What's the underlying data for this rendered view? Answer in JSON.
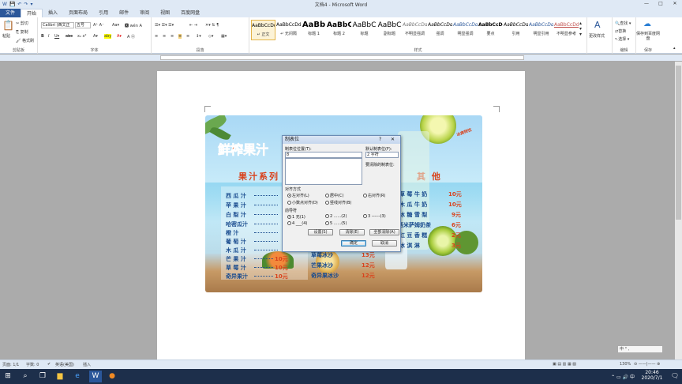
{
  "window": {
    "title": "文档4 - Microsoft Word",
    "minimize": "—",
    "maximize": "□",
    "close": "✕"
  },
  "quick_access": [
    "W",
    "💾",
    "↶",
    "↷",
    "▾"
  ],
  "tabs": [
    "文件",
    "开始",
    "插入",
    "页面布局",
    "引用",
    "邮件",
    "审阅",
    "视图",
    "百度网盘"
  ],
  "ribbon": {
    "clipboard": {
      "paste": "粘贴",
      "cut": "剪切",
      "copy": "复制",
      "format_painter": "格式刷",
      "label": "剪贴板"
    },
    "font": {
      "font_name": "Calibri (西文正",
      "font_size": "五号",
      "label": "字体"
    },
    "paragraph": {
      "label": "段落"
    },
    "styles": {
      "label": "样式",
      "items": [
        {
          "preview": "AaBbCcDd",
          "name": "↵ 正文"
        },
        {
          "preview": "AaBbCcDd",
          "name": "↵ 无间隔"
        },
        {
          "preview": "AaBb",
          "name": "标题 1"
        },
        {
          "preview": "AaBbC",
          "name": "标题 2"
        },
        {
          "preview": "AaBbC",
          "name": "标题"
        },
        {
          "preview": "AaBbC",
          "name": "副标题"
        },
        {
          "preview": "AaBbCcDd",
          "name": "不明显强调"
        },
        {
          "preview": "AaBbCcDd",
          "name": "强调"
        },
        {
          "preview": "AaBbCcDd",
          "name": "明显强调"
        },
        {
          "preview": "AaBbCcDd",
          "name": "要点"
        },
        {
          "preview": "AaBbCcDd",
          "name": "引用"
        },
        {
          "preview": "AaBbCcDd",
          "name": "明显引用"
        },
        {
          "preview": "AaBbCcDd",
          "name": "不明显参考"
        }
      ],
      "change_styles": "更改样式"
    },
    "editing": {
      "find": "查找 ▾",
      "replace": "替换",
      "select": "选择 ▾",
      "label": "编辑"
    },
    "save": {
      "button": "保存到百度网盘",
      "label": "保存"
    }
  },
  "menu_image": {
    "title": "鲜榨果汁",
    "juice_section": "果汁系列",
    "other_section": "其 他",
    "badge": "冰爽特饮",
    "juices": [
      {
        "name": "西 瓜 汁",
        "price": ""
      },
      {
        "name": "苹 果 汁",
        "price": ""
      },
      {
        "name": "白 梨 汁",
        "price": ""
      },
      {
        "name": "哈密瓜汁",
        "price": ""
      },
      {
        "name": "橙 汁",
        "price": ""
      },
      {
        "name": "葡 萄 汁",
        "price": ""
      },
      {
        "name": "木 瓜 汁",
        "price": ""
      },
      {
        "name": "芒 果 汁",
        "price": "10元"
      },
      {
        "name": "草 莓 汁",
        "price": "10元"
      },
      {
        "name": "奇异果汁",
        "price": "10元"
      }
    ],
    "middle": [
      {
        "name": "草莓冰沙",
        "price": "13元"
      },
      {
        "name": "芒果冰沙",
        "price": "12元"
      },
      {
        "name": "奇异果冰沙",
        "price": "12元"
      }
    ],
    "others": [
      {
        "name": "草 莓 牛 奶",
        "price": "10元"
      },
      {
        "name": "木 瓜 牛 奶",
        "price": "10元"
      },
      {
        "name": "冰 糖 雪 梨",
        "price": "9元"
      },
      {
        "name": "西米萨姆奶茶",
        "price": "6元"
      },
      {
        "name": "红 豆 香 糕",
        "price": "2元"
      },
      {
        "name": "冰 淇 淋",
        "price": "3元"
      }
    ]
  },
  "dialog": {
    "title": "制表位",
    "help": "?",
    "close": "✕",
    "tab_position_label": "制表位位置(T):",
    "tab_position_value": "8",
    "default_tabs_label": "默认制表位(F):",
    "default_tabs_value": "2 字符",
    "to_clear_label": "要清除的制表位:",
    "alignment_label": "对齐方式",
    "alignment": [
      {
        "label": "左对齐(L)",
        "selected": true
      },
      {
        "label": "居中(C)",
        "selected": false
      },
      {
        "label": "右对齐(R)",
        "selected": false
      },
      {
        "label": "小数点对齐(D)",
        "selected": false
      },
      {
        "label": "竖线对齐(B)",
        "selected": false
      }
    ],
    "leader_label": "前导符",
    "leaders": [
      {
        "label": "1 无(1)",
        "selected": true
      },
      {
        "label": "2 ......(2)",
        "selected": false
      },
      {
        "label": "3 ------(3)",
        "selected": false
      },
      {
        "label": "4 ___(4)",
        "selected": false
      },
      {
        "label": "5 ......(5)",
        "selected": false
      }
    ],
    "set_button": "设置(S)",
    "clear_button": "清除(E)",
    "clear_all_button": "全部清除(A)",
    "ok_button": "确定",
    "cancel_button": "取消"
  },
  "status_bar": {
    "page": "页面: 1/1",
    "words": "字数: 0",
    "language": "英语(美国)",
    "mode": "插入",
    "zoom": "130%"
  },
  "ime_bar": "中 ° ,",
  "taskbar": {
    "time": "20:46",
    "date": "2020/7/1"
  }
}
